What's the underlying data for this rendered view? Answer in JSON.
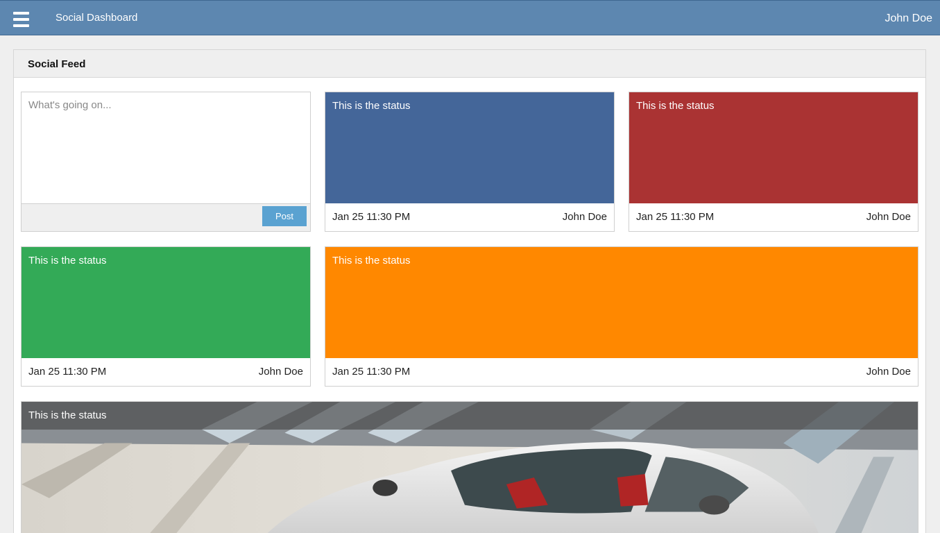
{
  "header": {
    "title": "Social Dashboard",
    "user": "John Doe"
  },
  "panel": {
    "title": "Social Feed"
  },
  "composer": {
    "placeholder": "What's going on...",
    "post_label": "Post"
  },
  "cards": [
    {
      "status": "This is the status",
      "date": "Jan 25 11:30 PM",
      "author": "John Doe",
      "color": "#446699"
    },
    {
      "status": "This is the status",
      "date": "Jan 25 11:30 PM",
      "author": "John Doe",
      "color": "#aa3333"
    },
    {
      "status": "This is the status",
      "date": "Jan 25 11:30 PM",
      "author": "John Doe",
      "color": "#33aa57"
    },
    {
      "status": "This is the status",
      "date": "Jan 25 11:30 PM",
      "author": "John Doe",
      "color": "#ff8800"
    }
  ],
  "photo_card": {
    "status": "This is the status"
  },
  "icons": {
    "menu": "hamburger-menu-icon"
  }
}
